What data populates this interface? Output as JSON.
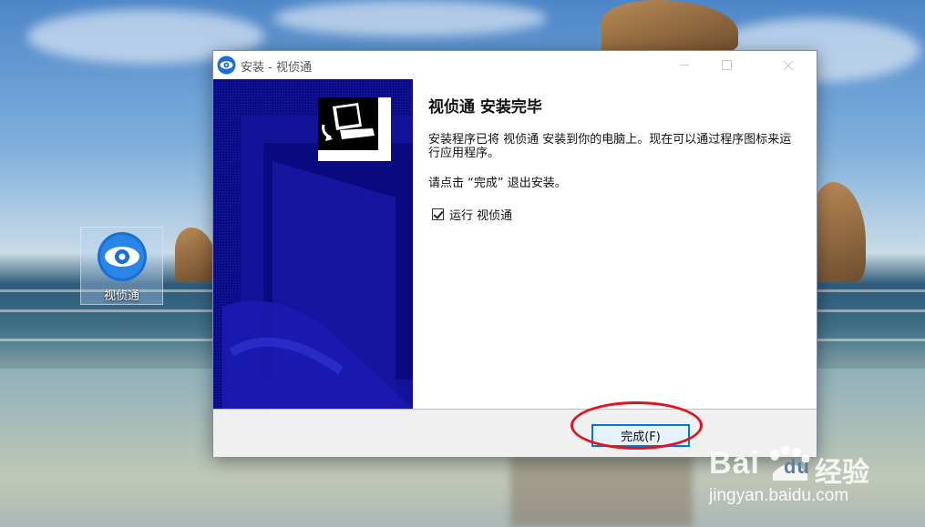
{
  "desktop": {
    "icon_label": "视侦通"
  },
  "window": {
    "title": "安装 - 视侦通",
    "heading": "视侦通  安装完毕",
    "paragraph1": "安装程序已将 视侦通 安装到你的电脑上。现在可以通过程序图标来运行应用程序。",
    "paragraph2": "请点击 “完成” 退出安装。",
    "run_checkbox_label": "运行 视侦通",
    "run_checkbox_checked": true,
    "finish_button_label": "完成(F)"
  },
  "watermark": {
    "brand_latin": "Bai",
    "brand_latin2": "du",
    "brand_cn": "经验",
    "url": "jingyan.baidu.com"
  },
  "colors": {
    "accent": "#0078d7",
    "banner": "#0a0a80",
    "highlight_oval": "#e0141e"
  }
}
